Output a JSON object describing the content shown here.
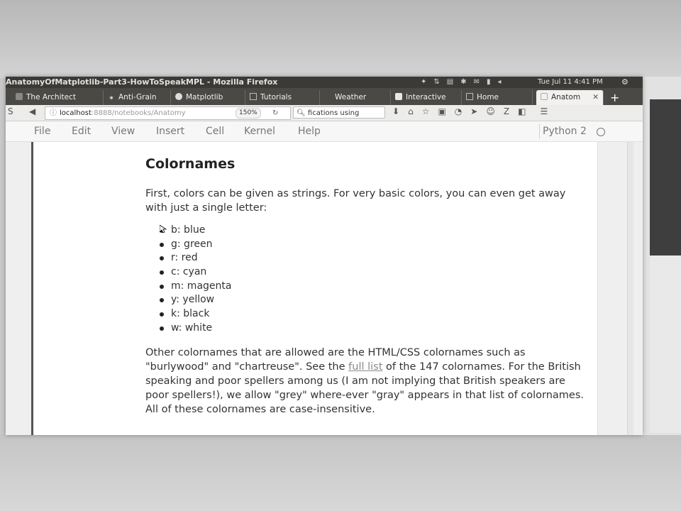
{
  "window": {
    "title": "AnatomyOfMatplotlib-Part3-HowToSpeakMPL - Mozilla Firefox",
    "clock": "Tue Jul 11  4:41 PM"
  },
  "tabs": [
    {
      "label": "The Architect"
    },
    {
      "label": "Anti-Grain"
    },
    {
      "label": "Matplotlib"
    },
    {
      "label": "Tutorials"
    },
    {
      "label": "Weather"
    },
    {
      "label": "Interactive"
    },
    {
      "label": "Home"
    },
    {
      "label": "Anatom",
      "active": true
    }
  ],
  "navbar": {
    "url_host": "localhost",
    "url_port": ":8888",
    "url_path": "/notebooks/Anatomy",
    "zoom": "150%",
    "search_value": "fications using"
  },
  "menu": {
    "items": [
      "File",
      "Edit",
      "View",
      "Insert",
      "Cell",
      "Kernel",
      "Help"
    ],
    "kernel": "Python 2"
  },
  "notebook": {
    "heading": "Colornames",
    "intro": "First, colors can be given as strings. For very basic colors, you can even get away with just a single letter:",
    "colors": [
      "b: blue",
      "g: green",
      "r: red",
      "c: cyan",
      "m: magenta",
      "y: yellow",
      "k: black",
      "w: white"
    ],
    "para2_before_link": "Other colornames that are allowed are the HTML/CSS colornames such as \"burlywood\" and \"chartreuse\". See the ",
    "para2_link": "full list",
    "para2_after_link": " of the 147 colornames. For the British speaking and poor spellers among us (I am not implying that British speakers are poor spellers!), we allow \"grey\" where-ever \"gray\" appears in that list of colornames. All of these colornames are case-insensitive."
  }
}
